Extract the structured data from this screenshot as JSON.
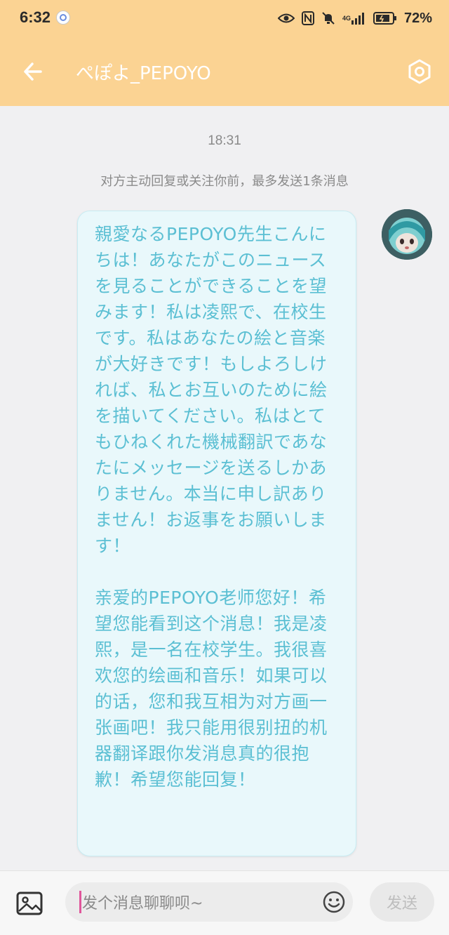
{
  "status_bar": {
    "time": "6:32",
    "network": "4G",
    "battery": "72%"
  },
  "header": {
    "title": "ぺぽよ_PEPOYO",
    "back_icon": "arrow-left-icon",
    "settings_icon": "hexagon-settings-icon"
  },
  "chat": {
    "timestamp": "18:31",
    "notice": "对方主动回复或关注你前，最多发送1条消息",
    "message": {
      "text": "親愛なるPEPOYO先生こんにちは！あなたがこのニュースを見ることができることを望みます！私は凌熙で、在校生です。私はあなたの絵と音楽が大好きです！もしよろしければ、私とお互いのために絵を描いてください。私はとてもひねくれた機械翻訳であなたにメッセージを送るしかありません。本当に申し訳ありません！お返事をお願いします！\n\n亲爱的PEPOYO老师您好！希望您能看到这个消息！我是凌熙，是一名在校学生。我很喜欢您的绘画和音乐！如果可以的话，您和我互相为对方画一张画吧！我只能用很别扭的机器翻译跟你发消息真的很抱歉！希望您能回复！"
    }
  },
  "composer": {
    "placeholder": "发个消息聊聊呗~",
    "send_label": "发送",
    "image_icon": "image-icon",
    "emoji_icon": "emoji-icon"
  },
  "colors": {
    "header_bg": "#fbd393",
    "bubble_bg": "#e9f8fb",
    "bubble_text": "#5bbfd3",
    "caret": "#e0569b"
  }
}
